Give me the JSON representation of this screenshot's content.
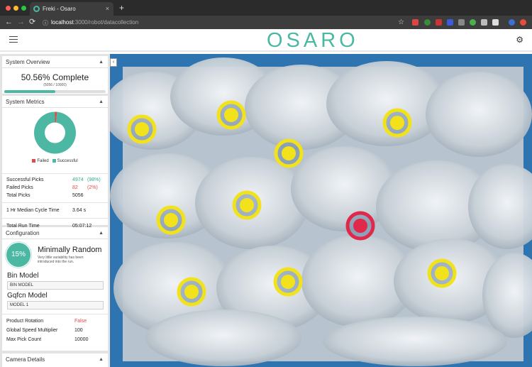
{
  "browser": {
    "tab_title": "Freki - Osaro",
    "tab_close": "×",
    "new_tab": "+",
    "url_host": "localhost",
    "url_path": ":3000/robot/datacollection",
    "nav": {
      "back": "←",
      "forward": "→",
      "reload": "⟳",
      "info": "ⓘ"
    },
    "star": "☆",
    "menu": "⋮"
  },
  "header": {
    "logo": "OSARO",
    "settings_icon": "⚙"
  },
  "overview": {
    "title": "System Overview",
    "percent_text": "50.56% Complete",
    "progress_text": "(5056 / 10000)",
    "progress_fraction": 0.5056
  },
  "metrics": {
    "title": "System Metrics",
    "legend_failed": "Failed",
    "legend_successful": "Successful",
    "successful_label": "Successful Picks",
    "successful_value": "4974",
    "successful_pct": "(98%)",
    "failed_label": "Failed Picks",
    "failed_value": "82",
    "failed_pct": "(2%)",
    "total_label": "Total Picks",
    "total_value": "5056",
    "cycle_label": "1 Hr Median Cycle Time",
    "cycle_value": "3.64 s",
    "runtime_label": "Total Run Time",
    "runtime_value": "05:07:12",
    "colors": {
      "success": "#4cb8a4",
      "failed": "#e04a4a"
    },
    "donut": {
      "successful": 4974,
      "failed": 82
    }
  },
  "configuration": {
    "title": "Configuration",
    "badge": "15%",
    "mode": "Minimally Random",
    "mode_desc": "Very little variability has been introduced into the run.",
    "bin_model_label": "Bin Model",
    "bin_model_value": "BIN MODEL",
    "gqfcn_label": "Gqfcn Model",
    "gqfcn_value": "MODEL 1",
    "rotation_label": "Product Rotation",
    "rotation_value": "False",
    "speed_label": "Global Speed Multiplier",
    "speed_value": "100",
    "max_label": "Max Pick Count",
    "max_value": "10000"
  },
  "camera": {
    "title": "Camera Details",
    "collapse": "‹",
    "pick_targets": [
      {
        "status": "candidate"
      },
      {
        "status": "candidate"
      },
      {
        "status": "candidate"
      },
      {
        "status": "candidate"
      },
      {
        "status": "candidate"
      },
      {
        "status": "candidate"
      },
      {
        "status": "candidate"
      },
      {
        "status": "failed"
      },
      {
        "status": "candidate"
      },
      {
        "status": "candidate"
      },
      {
        "status": "candidate"
      }
    ]
  },
  "caret": "▲"
}
